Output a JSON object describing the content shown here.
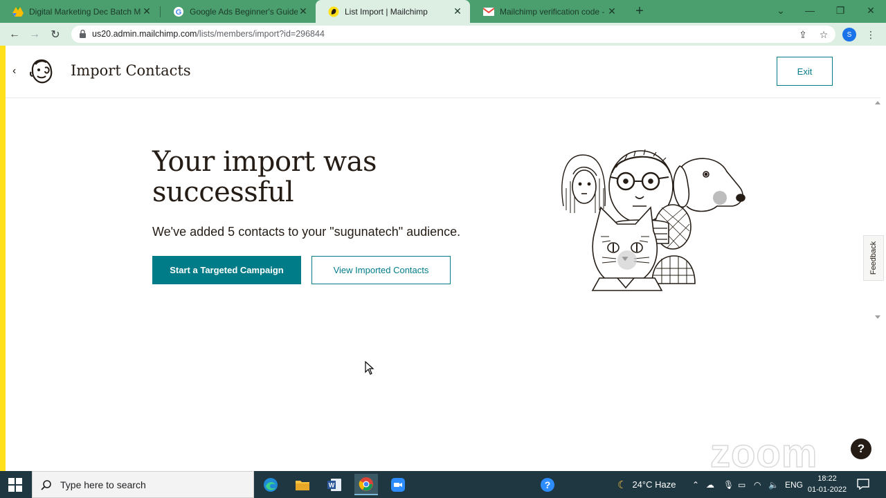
{
  "browser": {
    "tabs": [
      {
        "title": "Digital Marketing Dec Batch Ma",
        "icon": "google-drive-icon",
        "active": false
      },
      {
        "title": "Google Ads Beginner's Guide",
        "icon": "google-icon",
        "active": false
      },
      {
        "title": "List Import | Mailchimp",
        "icon": "mailchimp-icon",
        "active": true
      },
      {
        "title": "Mailchimp verification code - ma",
        "icon": "gmail-icon",
        "active": false
      }
    ],
    "url_host": "us20.admin.mailchimp.com",
    "url_path": "/lists/members/import?id=296844",
    "profile_initial": "S"
  },
  "header": {
    "title": "Import Contacts",
    "exit_label": "Exit"
  },
  "main": {
    "headline": "Your import was successful",
    "message": "We've added 5 contacts to your \"sugunatech\" audience.",
    "primary_button": "Start a Targeted Campaign",
    "secondary_button": "View Imported Contacts"
  },
  "feedback_label": "Feedback",
  "watermark": "zoom",
  "help_label": "?",
  "taskbar": {
    "search_placeholder": "Type here to search",
    "weather": "24°C  Haze",
    "language": "ENG",
    "time": "18:22",
    "date": "01-01-2022"
  },
  "colors": {
    "accent": "#007c89",
    "mailchimp_yellow": "#ffe01b",
    "browser_frame": "#4b9e6e",
    "text": "#241c15"
  }
}
